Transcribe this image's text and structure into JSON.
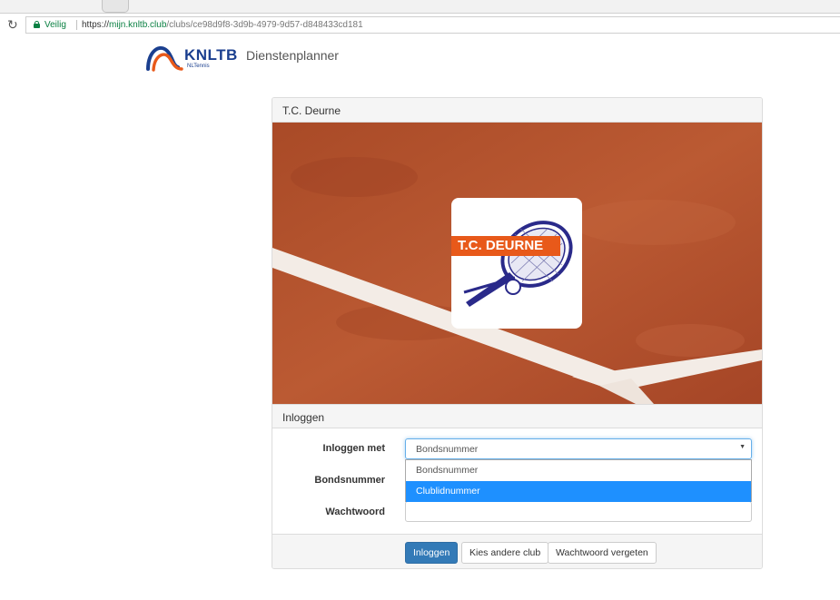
{
  "browser": {
    "secure_label": "Veilig",
    "url_scheme": "https://",
    "url_host": "mijn.knltb.club",
    "url_path": "/clubs/ce98d9f8-3d9b-4979-9d57-d848433cd181"
  },
  "header": {
    "logo_text": "KNLTB",
    "logo_subtext": "NLTennis",
    "app_title": "Dienstenplanner"
  },
  "club": {
    "name": "T.C. Deurne",
    "logo_text": "T.C. DEURNE"
  },
  "login": {
    "heading": "Inloggen",
    "login_with_label": "Inloggen met",
    "login_with_value": "Bondsnummer",
    "login_with_options": [
      "Bondsnummer",
      "Clublidnummer"
    ],
    "highlighted_option": "Clublidnummer",
    "member_number_label": "Bondsnummer",
    "password_label": "Wachtwoord"
  },
  "actions": {
    "login_button": "Inloggen",
    "choose_club_button": "Kies andere club",
    "forgot_password_button": "Wachtwoord vergeten"
  },
  "colors": {
    "primary": "#337ab7",
    "highlight": "#1e90ff",
    "brand_blue": "#1b3f8f",
    "brand_orange": "#e8591a",
    "clay": "#b5532e"
  },
  "icons": [
    "reload-icon",
    "lock-icon",
    "chevron-down-icon"
  ]
}
